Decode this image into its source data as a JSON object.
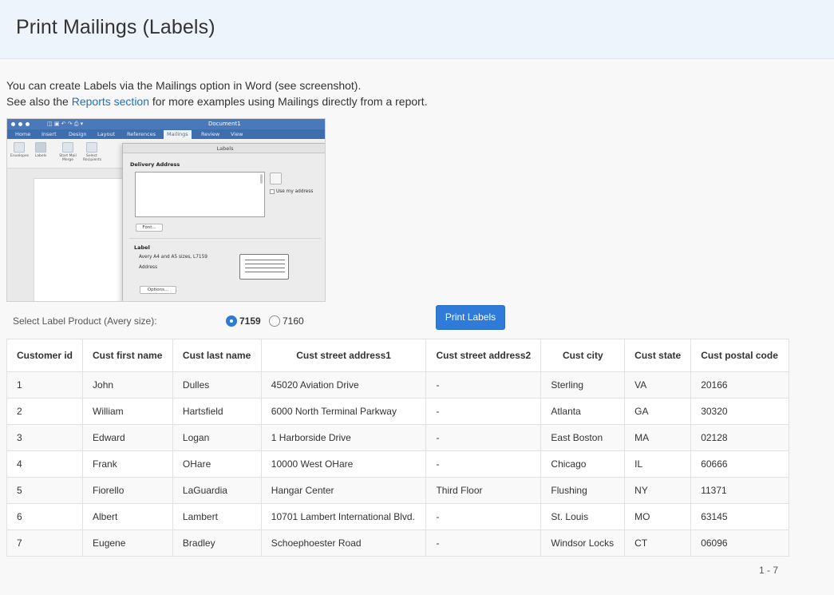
{
  "header": {
    "title": "Print Mailings (Labels)"
  },
  "intro": {
    "line1": "You can create Labels via the Mailings option in Word (see screenshot).",
    "line2_before": "See also the ",
    "line2_link": "Reports section",
    "line2_after": " for more examples using Mailings directly from a report."
  },
  "screenshot": {
    "doc_name": "Document1",
    "tabs": [
      "Home",
      "Insert",
      "Design",
      "Layout",
      "References",
      "Mailings",
      "Review",
      "View"
    ],
    "ribbon": [
      {
        "label": "Envelopes"
      },
      {
        "label": "Labels"
      },
      {
        "label": "Start Mail Merge"
      },
      {
        "label": "Select Recipients"
      }
    ],
    "dialog_title": "Labels",
    "delivery_address": "Delivery Address",
    "use_my_address": "Use my address",
    "font_btn": "Font...",
    "label_heading": "Label",
    "label_product": "Avery A4 and A5 sizes, L7159",
    "label_type": "Address",
    "options_btn": "Options..."
  },
  "controls": {
    "select_label": "Select Label Product (Avery size):",
    "options": [
      {
        "value": "7159",
        "checked": true
      },
      {
        "value": "7160",
        "checked": false
      }
    ],
    "print_button": "Print Labels"
  },
  "table": {
    "columns": [
      "Customer id",
      "Cust first name",
      "Cust last name",
      "Cust street address1",
      "Cust street address2",
      "Cust city",
      "Cust state",
      "Cust postal code"
    ],
    "rows": [
      [
        "1",
        "John",
        "Dulles",
        "45020 Aviation Drive",
        "-",
        "Sterling",
        "VA",
        "20166"
      ],
      [
        "2",
        "William",
        "Hartsfield",
        "6000 North Terminal Parkway",
        "-",
        "Atlanta",
        "GA",
        "30320"
      ],
      [
        "3",
        "Edward",
        "Logan",
        "1 Harborside Drive",
        "-",
        "East Boston",
        "MA",
        "02128"
      ],
      [
        "4",
        "Frank",
        "OHare",
        "10000 West OHare",
        "-",
        "Chicago",
        "IL",
        "60666"
      ],
      [
        "5",
        "Fiorello",
        "LaGuardia",
        "Hangar Center",
        "Third Floor",
        "Flushing",
        "NY",
        "11371"
      ],
      [
        "6",
        "Albert",
        "Lambert",
        "10701 Lambert International Blvd.",
        "-",
        "St. Louis",
        "MO",
        "63145"
      ],
      [
        "7",
        "Eugene",
        "Bradley",
        "Schoephoester Road",
        "-",
        "Windsor Locks",
        "CT",
        "06096"
      ]
    ]
  },
  "pagination": {
    "range": "1 - 7"
  },
  "colors": {
    "accent": "#2f7bd9",
    "link": "#1a6fc9",
    "header_bg": "#eef4fc"
  }
}
